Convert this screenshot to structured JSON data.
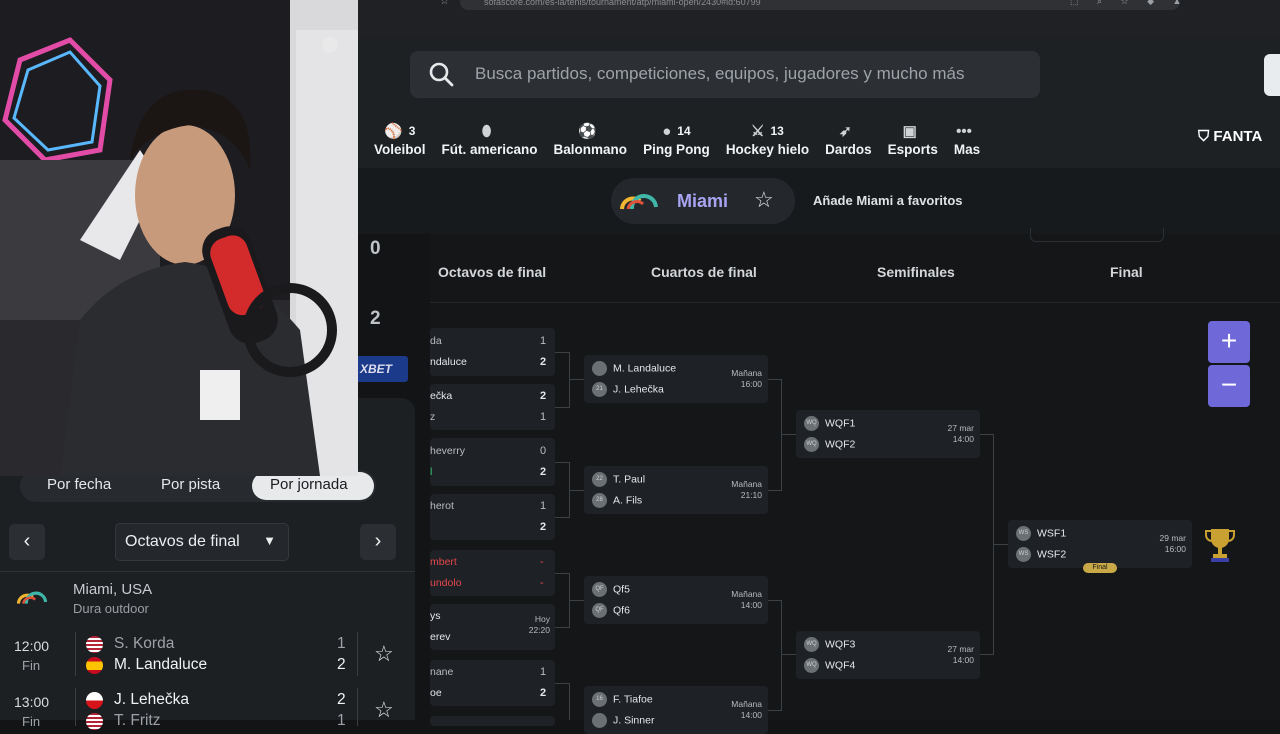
{
  "browser": {
    "url": "sofascore.com/es-la/tenis/tournament/atp/miami-open/2430#id:60799"
  },
  "header": {
    "search_placeholder": "Busca partidos, competiciones, equipos, jugadores y mucho más",
    "sports": [
      {
        "icon": "volleyball-icon",
        "glyph": "⚾",
        "count": "3",
        "label": "Voleibol"
      },
      {
        "icon": "american-football-icon",
        "glyph": "⬮",
        "count": "",
        "label": "Fút. americano"
      },
      {
        "icon": "handball-icon",
        "glyph": "⚽",
        "count": "",
        "label": "Balonmano"
      },
      {
        "icon": "ping-pong-icon",
        "glyph": "●",
        "count": "14",
        "label": "Ping Pong"
      },
      {
        "icon": "ice-hockey-icon",
        "glyph": "⚔",
        "count": "13",
        "label": "Hockey hielo"
      },
      {
        "icon": "darts-icon",
        "glyph": "➶",
        "count": "",
        "label": "Dardos"
      },
      {
        "icon": "esports-icon",
        "glyph": "▣",
        "count": "",
        "label": "Esports"
      },
      {
        "icon": "more-icon",
        "glyph": "•••",
        "count": "",
        "label": "Mas"
      }
    ],
    "fantasy_label": "FANTA"
  },
  "tournament_bar": {
    "name": "Miami",
    "favorite_text": "Añade Miami a favoritos"
  },
  "bracket": {
    "rounds": [
      "Octavos de final",
      "Cuartos de final",
      "Semifinales",
      "Final"
    ],
    "r16": [
      {
        "p1": "da",
        "p2": "ndaluce",
        "s1": "1",
        "s2": "2"
      },
      {
        "p1": "ečka",
        "p2": "z",
        "s1": "2",
        "s2": "1"
      },
      {
        "p1": "heverry",
        "p2": "l",
        "s1": "0",
        "s2": "2"
      },
      {
        "p1": "herot",
        "p2": "",
        "s1": "1",
        "s2": "2"
      },
      {
        "p1": "mbert",
        "p2": "undolo",
        "s1": "-",
        "s2": "-"
      },
      {
        "p1": "ys",
        "p2": "erev",
        "s1": "Hoy",
        "s2": "22:20"
      },
      {
        "p1": "nane",
        "p2": "oe",
        "s1": "1",
        "s2": "2"
      }
    ],
    "qf": [
      {
        "p1": "M. Landaluce",
        "p2": "J. Lehečka",
        "a1": "",
        "a2": "21",
        "day": "Mañana",
        "time": "16:00"
      },
      {
        "p1": "T. Paul",
        "p2": "A. Fils",
        "a1": "22",
        "a2": "28",
        "day": "Mañana",
        "time": "21:10"
      },
      {
        "p1": "Qf5",
        "p2": "Qf6",
        "a1": "QF",
        "a2": "QF",
        "day": "Mañana",
        "time": "14:00"
      },
      {
        "p1": "F. Tiafoe",
        "p2": "J. Sinner",
        "a1": "16",
        "a2": "",
        "day": "Mañana",
        "time": "14:00"
      }
    ],
    "sf": [
      {
        "p1": "WQF1",
        "p2": "WQF2",
        "a1": "WQ",
        "a2": "WQ",
        "day": "27 mar",
        "time": "14:00"
      },
      {
        "p1": "WQF3",
        "p2": "WQF4",
        "a1": "WQ",
        "a2": "WQ",
        "day": "27 mar",
        "time": "14:00"
      }
    ],
    "final": {
      "p1": "WSF1",
      "p2": "WSF2",
      "a1": "WS",
      "a2": "WS",
      "day": "29 mar",
      "time": "16:00",
      "badge": "Final"
    },
    "zoom_in": "+",
    "zoom_out": "−"
  },
  "left_strip": {
    "score_a": "0",
    "score_b": "2",
    "sponsor": "XBET"
  },
  "left_panel": {
    "tabs": [
      "Por fecha",
      "Por pista",
      "Por jornada"
    ],
    "round_select": "Octavos de final",
    "tournament_name": "Miami, USA",
    "surface": "Dura outdoor",
    "matches": [
      {
        "time": "12:00",
        "status": "Fin",
        "p1": "S. Korda",
        "p2": "M. Landaluce",
        "s1": "1",
        "s2": "2",
        "flag1": "us",
        "flag2": "es"
      },
      {
        "time": "13:00",
        "status": "Fin",
        "p1": "J. Lehečka",
        "p2": "T. Fritz",
        "s1": "2",
        "s2": "1",
        "flag1": "cz",
        "flag2": "us"
      }
    ]
  },
  "colors": {
    "accent": "#6f68d8",
    "tournament_name": "#a8a4f2",
    "final_badge": "#c9a847",
    "live_red": "#e5484d"
  }
}
